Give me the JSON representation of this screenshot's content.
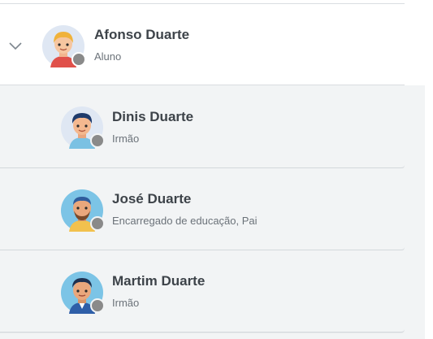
{
  "parent": {
    "name": "Afonso Duarte",
    "role": "Aluno",
    "expand_icon": "chevron-down-icon",
    "status_color": "#8a8a8a"
  },
  "relatives": [
    {
      "name": "Dinis Duarte",
      "role": "Irmão"
    },
    {
      "name": "José Duarte",
      "role": "Encarregado de educação, Pai"
    },
    {
      "name": "Martim Duarte",
      "role": "Irmão"
    }
  ]
}
